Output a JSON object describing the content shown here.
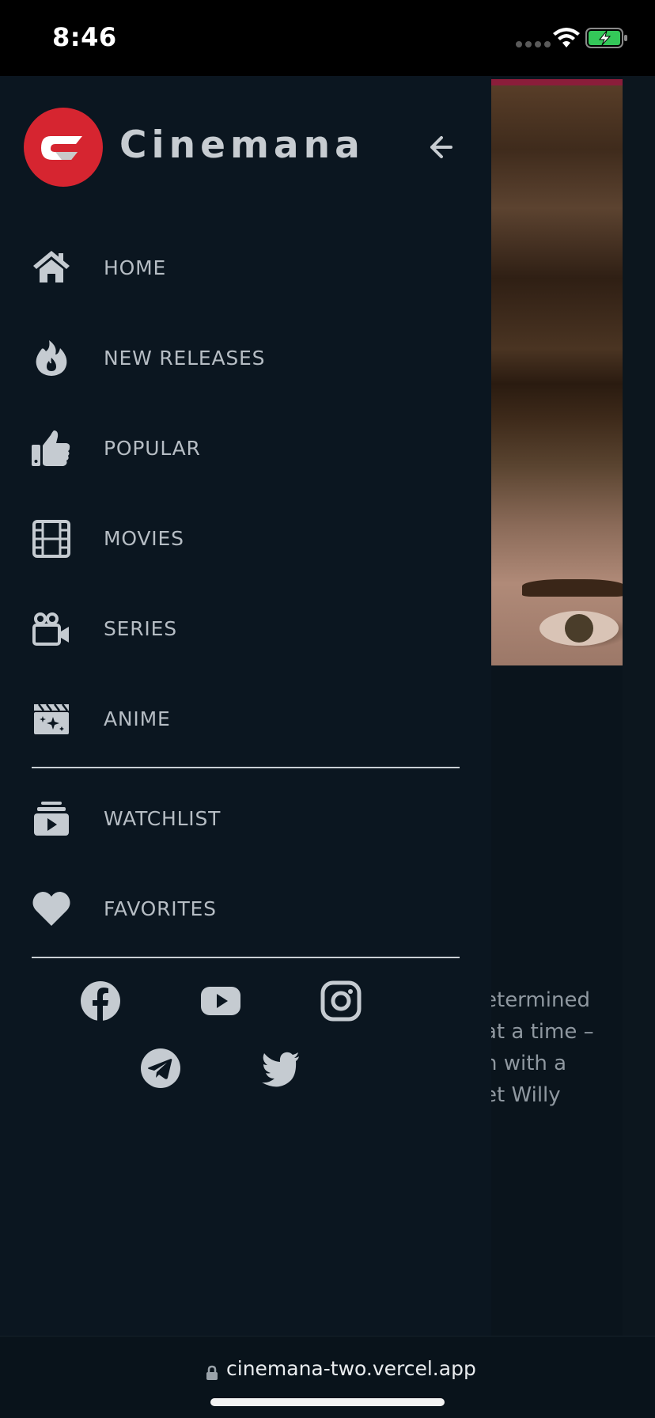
{
  "status_bar": {
    "time": "8:46"
  },
  "brand": {
    "name": "Cinemana",
    "logo_color": "#d62530"
  },
  "menu": {
    "items": [
      {
        "label": "HOME",
        "icon": "home-icon"
      },
      {
        "label": "NEW RELEASES",
        "icon": "fire-icon"
      },
      {
        "label": "POPULAR",
        "icon": "thumbs-up-icon"
      },
      {
        "label": "MOVIES",
        "icon": "film-icon"
      },
      {
        "label": "SERIES",
        "icon": "video-camera-icon"
      },
      {
        "label": "ANIME",
        "icon": "clapperboard-sparkle-icon"
      }
    ],
    "user_items": [
      {
        "label": "WATCHLIST",
        "icon": "playlist-icon"
      },
      {
        "label": "FAVORITES",
        "icon": "heart-icon"
      }
    ]
  },
  "social": [
    "facebook-icon",
    "youtube-icon",
    "instagram-icon",
    "telegram-icon",
    "twitter-icon"
  ],
  "background_page": {
    "description_lines": [
      "etermined",
      "at a time –",
      "n with a",
      "et Willy"
    ]
  },
  "url_bar": {
    "url": "cinemana-two.vercel.app"
  },
  "colors": {
    "drawer_bg": "#0b1620",
    "text": "#b6bdc4",
    "accent": "#d62530"
  }
}
